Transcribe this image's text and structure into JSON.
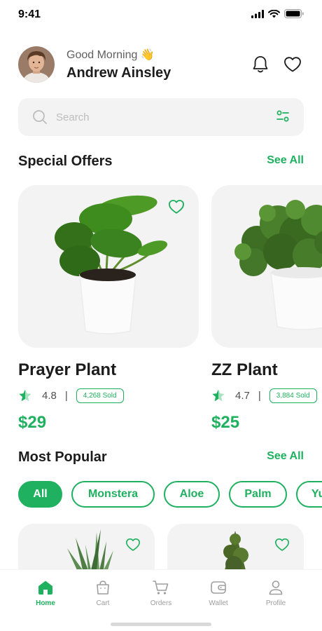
{
  "status_bar": {
    "time": "9:41"
  },
  "header": {
    "greeting": "Good Morning 👋",
    "user_name": "Andrew Ainsley",
    "icons": [
      "bell-icon",
      "heart-icon"
    ]
  },
  "search": {
    "placeholder": "Search",
    "value": "",
    "icon": "search-icon",
    "filter_icon": "filter-icon"
  },
  "special_offers": {
    "title": "Special Offers",
    "see_all": "See All",
    "items": [
      {
        "name": "Prayer Plant",
        "rating": "4.8",
        "separator": "|",
        "sold": "4,268 Sold",
        "price": "$29"
      },
      {
        "name": "ZZ Plant",
        "rating": "4.7",
        "separator": "|",
        "sold": "3,884 Sold",
        "price": "$25"
      }
    ]
  },
  "most_popular": {
    "title": "Most Popular",
    "see_all": "See All",
    "chips": [
      "All",
      "Monstera",
      "Aloe",
      "Palm",
      "Yucca"
    ],
    "active_chip": "All"
  },
  "bottom_nav": {
    "items": [
      {
        "label": "Home",
        "icon": "home-icon",
        "active": true
      },
      {
        "label": "Cart",
        "icon": "cart-icon",
        "active": false
      },
      {
        "label": "Orders",
        "icon": "orders-icon",
        "active": false
      },
      {
        "label": "Wallet",
        "icon": "wallet-icon",
        "active": false
      },
      {
        "label": "Profile",
        "icon": "profile-icon",
        "active": false
      }
    ]
  },
  "colors": {
    "accent": "#1fb15f",
    "card_bg": "#f3f3f3",
    "text": "#1c1c1c",
    "muted": "#9e9e9e"
  }
}
